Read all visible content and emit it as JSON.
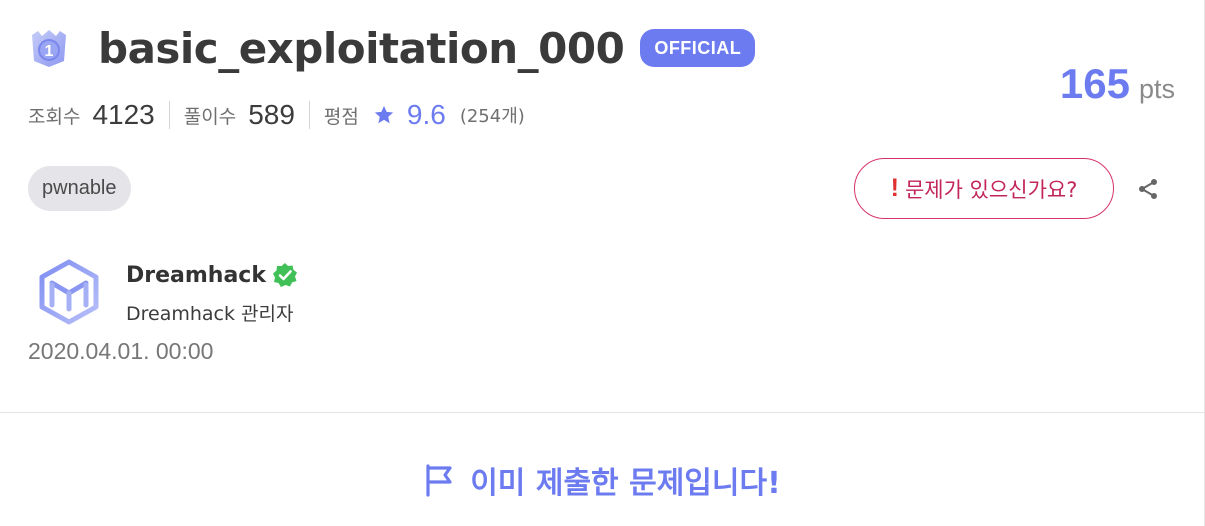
{
  "challenge": {
    "level": "1",
    "title": "basic_exploitation_000",
    "official_badge": "OFFICIAL",
    "points": "165",
    "points_unit": "pts",
    "stats": {
      "views_label": "조회수",
      "views": "4123",
      "solves_label": "풀이수",
      "solves": "589",
      "rating_label": "평점",
      "rating": "9.6",
      "rating_count": "(254개)"
    },
    "tag": "pwnable",
    "report_label": "문제가 있으신가요?",
    "report_mark": "!"
  },
  "author": {
    "name": "Dreamhack",
    "role": "Dreamhack 관리자",
    "date": "2020.04.01. 00:00"
  },
  "status": {
    "submitted_text": "이미 제출한 문제입니다!"
  },
  "colors": {
    "accent": "#6c7cf0",
    "report": "#d6336c",
    "verified": "#40c057"
  },
  "icons": {
    "level": "level-badge-icon",
    "star": "star-icon",
    "share": "share-icon",
    "verified": "verified-icon",
    "flag": "flag-icon",
    "avatar": "dreamhack-logo"
  }
}
